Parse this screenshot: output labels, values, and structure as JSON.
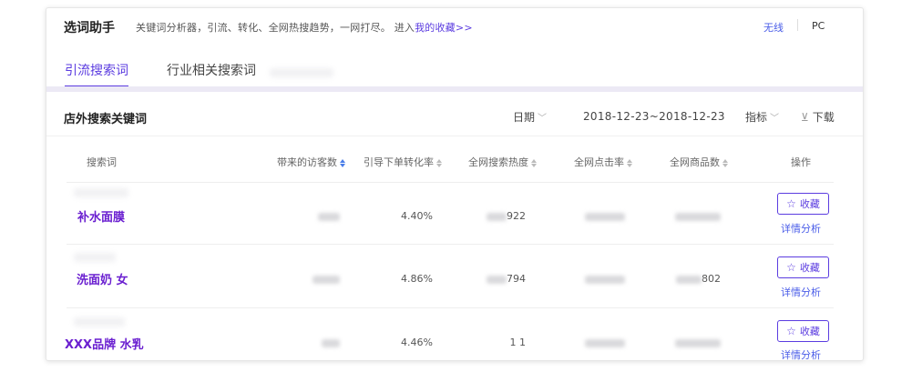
{
  "header": {
    "brand": "选词助手",
    "slogan": "关键词分析器，引流、转化、全网热搜趋势，一网打尽。 进入",
    "favorites_link": "我的收藏>>",
    "device_wireless": "无线",
    "device_pc": "PC"
  },
  "tabs": [
    {
      "label": "引流搜索词",
      "active": true
    },
    {
      "label": "行业相关搜索词",
      "active": false
    }
  ],
  "section": {
    "title": "店外搜索关键词",
    "date_filter": "日期",
    "date_range": "2018-12-23~2018-12-23",
    "metric_filter": "指标",
    "download": "下载"
  },
  "table": {
    "columns": [
      "搜索词",
      "带来的访客数",
      "引导下单转化率",
      "全网搜索热度",
      "全网点击率",
      "全网商品数",
      "操作"
    ],
    "rows": [
      {
        "keyword": "补水面膜",
        "conversion": "4.40%",
        "heat_visible": "922",
        "products_visible": "",
        "fav": "收藏",
        "detail": "详情分析"
      },
      {
        "keyword": "洗面奶 女",
        "conversion": "4.86%",
        "heat_visible": "794",
        "products_visible": "802",
        "fav": "收藏",
        "detail": "详情分析"
      },
      {
        "keyword": "XXX品牌 水乳",
        "conversion": "4.46%",
        "heat_visible": "1   1",
        "products_visible": "",
        "fav": "收藏",
        "detail": "详情分析"
      }
    ]
  },
  "icons": {
    "star": "star-icon",
    "download": "download-icon",
    "sort": "sort-icon",
    "chevron": "chevron-down-icon"
  },
  "colors": {
    "accent": "#5b3ce0",
    "keyword": "#6a1fd0",
    "link": "#4a5de8"
  }
}
